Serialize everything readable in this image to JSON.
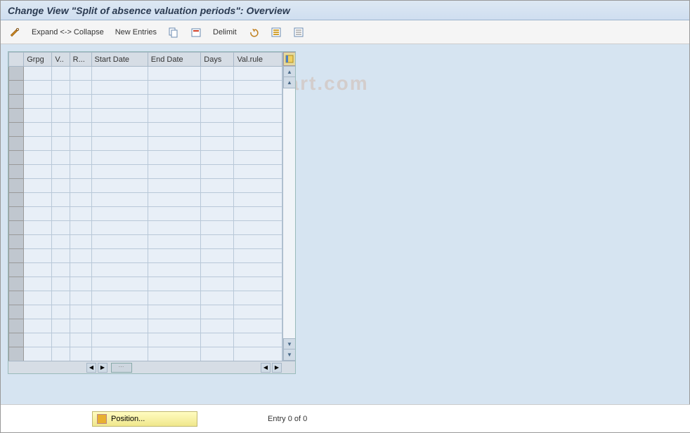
{
  "title": "Change View \"Split of absence valuation periods\": Overview",
  "toolbar": {
    "toggle_label": "Expand <-> Collapse",
    "new_entries_label": "New Entries",
    "delimit_label": "Delimit"
  },
  "table": {
    "columns": [
      "Grpg",
      "V..",
      "R...",
      "Start Date",
      "End Date",
      "Days",
      "Val.rule"
    ],
    "rows": [],
    "empty_row_count": 21
  },
  "footer": {
    "position_label": "Position...",
    "entry_text": "Entry 0 of 0"
  },
  "watermark": "www.tutorialkart.com",
  "icons": {
    "edit": "edit-pencil-icon",
    "copy": "copy-icon",
    "delete": "delete-icon",
    "select_all": "select-all-icon",
    "deselect_all": "deselect-all-icon",
    "config": "table-settings-icon"
  }
}
